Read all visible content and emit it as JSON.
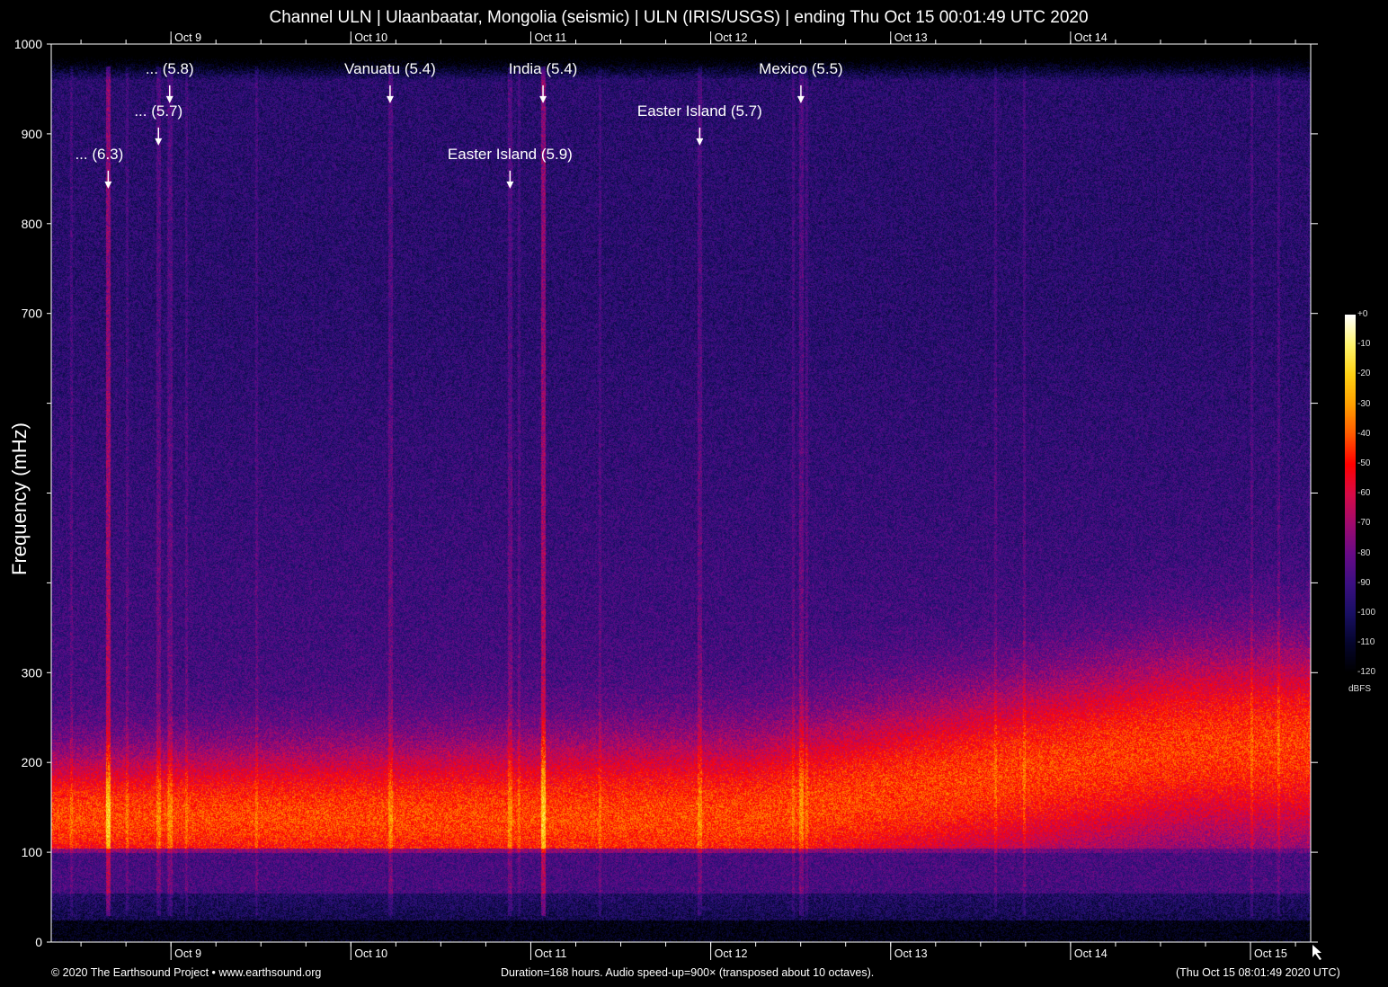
{
  "title": "Channel ULN | Ulaanbaatar, Mongolia (seismic) | ULN (IRIS/USGS) | ending Thu Oct 15 00:01:49 UTC 2020",
  "footer": {
    "left": "© 2020 The Earthsound Project • www.earthsound.org",
    "center": "Duration=168 hours. Audio speed-up=900× (transposed about 10 octaves).",
    "right": "(Thu Oct 15 08:01:49 2020 UTC)"
  },
  "chart_data": {
    "type": "heatmap",
    "title": "Channel ULN | Ulaanbaatar, Mongolia (seismic) | ULN (IRIS/USGS) | ending Thu Oct 15 00:01:49 UTC 2020",
    "xlabel": "",
    "ylabel": "Frequency (mHz)",
    "x_unit": "hours since Oct 8 08:01:49 UTC",
    "xlim": [
      0,
      168
    ],
    "ylim": [
      0,
      1000
    ],
    "y_ticks": [
      0,
      100,
      200,
      300,
      400,
      500,
      600,
      700,
      800,
      900,
      1000
    ],
    "y_tick_labels": [
      "0",
      "100",
      "200",
      "300",
      "",
      "",
      "",
      "700",
      "800",
      "900",
      "1000"
    ],
    "x_day_ticks_hours": [
      15.97,
      39.97,
      63.97,
      87.97,
      111.97,
      135.97,
      159.97
    ],
    "x_tick_labels_bottom": [
      "Oct  9",
      "Oct 10",
      "Oct 11",
      "Oct 12",
      "Oct 13",
      "Oct 14",
      "Oct 15"
    ],
    "x_tick_labels_top": [
      "Oct  9",
      "Oct 10",
      "Oct 11",
      "Oct 12",
      "Oct 13",
      "Oct 14"
    ],
    "minor_tick_interval_hours": 6,
    "colorbar": {
      "label": "dBFS",
      "range": [
        -120,
        0
      ],
      "ticks": [
        "+0",
        "-10",
        "-20",
        "-30",
        "-40",
        "-50",
        "-60",
        "-70",
        "-80",
        "-90",
        "-100",
        "-110",
        "-120"
      ],
      "colors": [
        "#000000",
        "#000033",
        "#1a0a66",
        "#4a0f8a",
        "#8a0f8a",
        "#c8105a",
        "#ff0000",
        "#ff6a00",
        "#ffc000",
        "#ffff80",
        "#ffffff"
      ]
    },
    "annotations": [
      {
        "label": "... (6.3)",
        "hour": 7.6,
        "freq": 839
      },
      {
        "label": "... (5.7)",
        "hour": 14.3,
        "freq": 887
      },
      {
        "label": "... (5.8)",
        "hour": 15.8,
        "freq": 934
      },
      {
        "label": "Vanuatu (5.4)",
        "hour": 45.2,
        "freq": 934
      },
      {
        "label": "Easter Island (5.9)",
        "hour": 61.2,
        "freq": 839
      },
      {
        "label": "India (5.4)",
        "hour": 65.6,
        "freq": 934
      },
      {
        "label": "Easter Island (5.7)",
        "hour": 86.5,
        "freq": 887
      },
      {
        "label": "Mexico (5.5)",
        "hour": 100.0,
        "freq": 934
      }
    ],
    "band": {
      "description_peak_freq_mHz": [
        140,
        220
      ],
      "peak_dBFS": -50,
      "background_dBFS": -92
    }
  }
}
